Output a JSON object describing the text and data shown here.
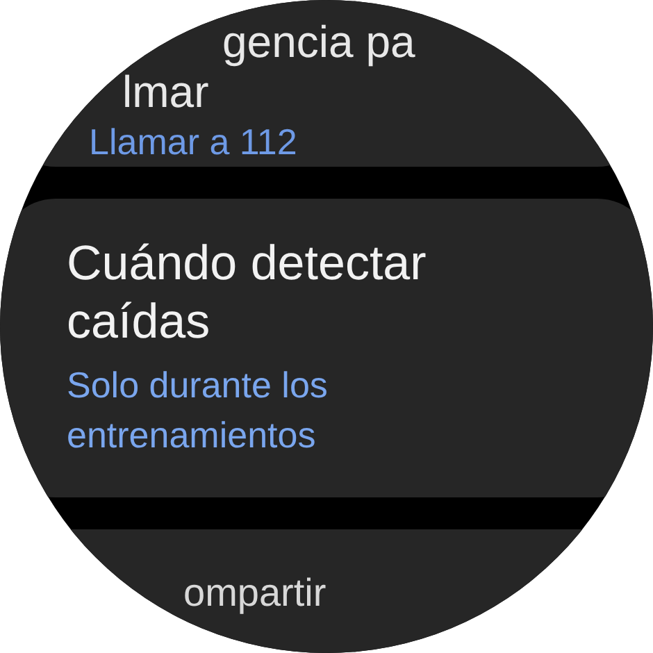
{
  "items": [
    {
      "title_lines": [
        "gencia pa",
        "lmar"
      ],
      "subtitle": "Llamar a 112",
      "kind": "top"
    },
    {
      "title_lines": [
        "Cuándo detectar",
        "caídas"
      ],
      "subtitle_lines": [
        "Solo durante los",
        "entrenamientos"
      ],
      "kind": "middle"
    },
    {
      "title_lines": [
        "ompartir"
      ],
      "kind": "bottom"
    }
  ]
}
